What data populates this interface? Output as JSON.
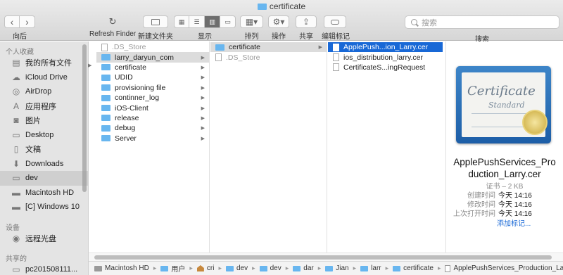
{
  "window": {
    "title": "certificate"
  },
  "toolbar": {
    "back_label": "向后",
    "back_glyph": "‹",
    "forward_glyph": "›",
    "refresh_label": "Refresh Finder",
    "new_folder_label": "新建文件夹",
    "view_label": "显示",
    "arrange_label": "排列",
    "action_label": "操作",
    "share_label": "共享",
    "tags_label": "编辑标记",
    "search_label": "搜索",
    "search_placeholder": "搜索"
  },
  "sidebar": {
    "sections": [
      {
        "header": "个人收藏",
        "items": [
          {
            "label": "我的所有文件",
            "icon": "all-files-icon"
          },
          {
            "label": "iCloud Drive",
            "icon": "cloud-icon"
          },
          {
            "label": "AirDrop",
            "icon": "airdrop-icon"
          },
          {
            "label": "应用程序",
            "icon": "applications-icon"
          },
          {
            "label": "图片",
            "icon": "camera-icon"
          },
          {
            "label": "Desktop",
            "icon": "desktop-icon"
          },
          {
            "label": "文稿",
            "icon": "document-icon"
          },
          {
            "label": "Downloads",
            "icon": "download-icon"
          },
          {
            "label": "dev",
            "icon": "folder-icon",
            "selected": true
          },
          {
            "label": "Macintosh HD",
            "icon": "hard-drive-icon"
          },
          {
            "label": "[C] Windows 10",
            "icon": "hard-drive-icon"
          }
        ]
      },
      {
        "header": "设备",
        "items": [
          {
            "label": "远程光盘",
            "icon": "disc-icon"
          }
        ]
      },
      {
        "header": "共享的",
        "items": [
          {
            "label": "pc201508111...",
            "icon": "computer-icon"
          }
        ]
      }
    ]
  },
  "columns": [
    {
      "items": [
        {
          "label": ".DS_Store",
          "kind": "file",
          "dim": true
        },
        {
          "label": "larry_daryun_com",
          "kind": "folder",
          "selected": "grey",
          "arrow": true
        },
        {
          "label": "certificate",
          "kind": "folder",
          "arrow": true
        },
        {
          "label": "UDID",
          "kind": "folder",
          "arrow": true
        },
        {
          "label": "provisioning file",
          "kind": "folder",
          "arrow": true
        },
        {
          "label": "continner_log",
          "kind": "folder",
          "arrow": true
        },
        {
          "label": "iOS-Client",
          "kind": "folder",
          "arrow": true
        },
        {
          "label": "release",
          "kind": "folder",
          "arrow": true
        },
        {
          "label": "debug",
          "kind": "folder",
          "arrow": true
        },
        {
          "label": "Server",
          "kind": "folder",
          "arrow": true
        }
      ]
    },
    {
      "items": [
        {
          "label": "certificate",
          "kind": "folder",
          "selected": "grey",
          "arrow": true
        },
        {
          "label": ".DS_Store",
          "kind": "file",
          "dim": true
        }
      ]
    },
    {
      "items": [
        {
          "label": "ApplePush...ion_Larry.cer",
          "kind": "file",
          "selected": "blue"
        },
        {
          "label": "ios_distribution_larry.cer",
          "kind": "file"
        },
        {
          "label": "CertificateS...ingRequest",
          "kind": "file"
        }
      ]
    }
  ],
  "preview": {
    "cert_title": "Certificate",
    "cert_subtitle": "Standard",
    "file_name_line1": "ApplePushServices_Pro",
    "file_name_line2": "duction_Larry.cer",
    "kind": "证书 – 2 KB",
    "rows": [
      {
        "key": "创建时间",
        "value": "今天 14:16"
      },
      {
        "key": "修改时间",
        "value": "今天 14:16"
      },
      {
        "key": "上次打开时间",
        "value": "今天 14:16"
      }
    ],
    "add_tags": "添加标记..."
  },
  "pathbar": [
    {
      "label": "Macintosh HD",
      "icon": "hard-drive-icon"
    },
    {
      "label": "用户",
      "icon": "folder-icon"
    },
    {
      "label": "cri",
      "icon": "home-icon"
    },
    {
      "label": "dev",
      "icon": "folder-icon"
    },
    {
      "label": "dev",
      "icon": "folder-icon"
    },
    {
      "label": "dar",
      "icon": "folder-icon"
    },
    {
      "label": "Jian",
      "icon": "folder-icon"
    },
    {
      "label": "larr",
      "icon": "folder-icon"
    },
    {
      "label": "certificate",
      "icon": "folder-icon"
    },
    {
      "label": "ApplePushServices_Production_Larry.cer",
      "icon": "document-icon"
    }
  ],
  "colors": {
    "selection_blue": "#1868d6",
    "folder_blue": "#68b6ef",
    "sidebar_bg": "#e4e4e4"
  }
}
